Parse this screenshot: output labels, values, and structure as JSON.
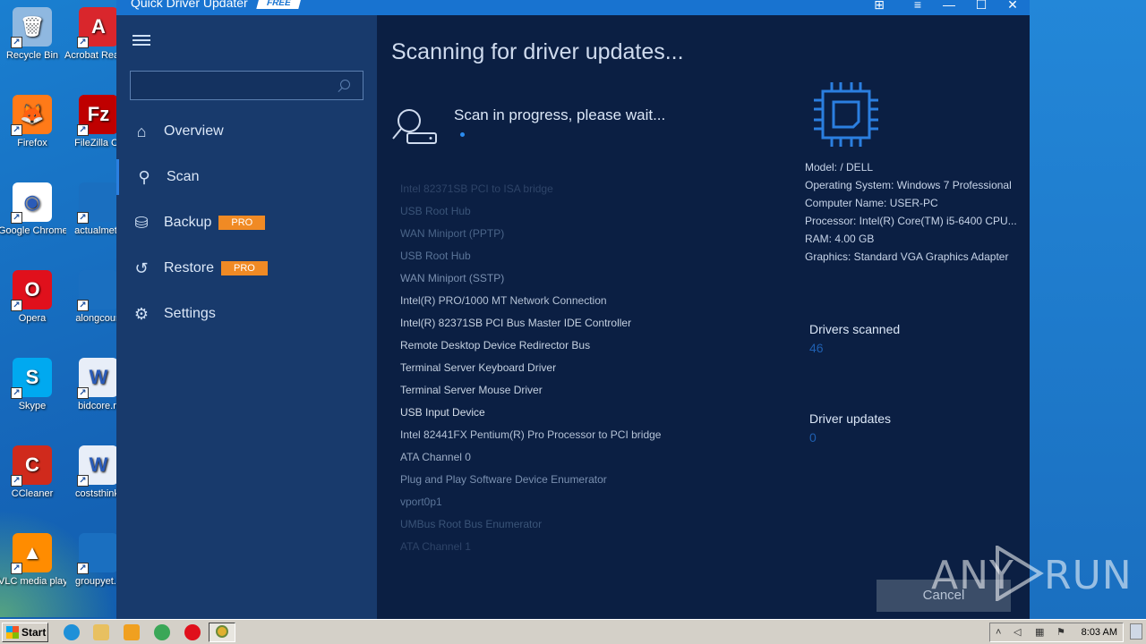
{
  "desktop": {
    "icons": [
      {
        "label": "Recycle Bin",
        "glyph": "🗑",
        "color": "#8fb8e0"
      },
      {
        "label": "Acrobat Reader D",
        "glyph": "A",
        "color": "#d9262c"
      },
      {
        "label": "Firefox",
        "glyph": "🦊",
        "color": "#ff7a18"
      },
      {
        "label": "FileZilla Cli",
        "glyph": "Fz",
        "color": "#bf0000"
      },
      {
        "label": "Google Chrome",
        "glyph": "◉",
        "color": "#ffffff"
      },
      {
        "label": "actualmeta",
        "glyph": "",
        "color": "#1a6fc0"
      },
      {
        "label": "Opera",
        "glyph": "O",
        "color": "#e0101c"
      },
      {
        "label": "alongcourt",
        "glyph": "",
        "color": "#1a6fc0"
      },
      {
        "label": "Skype",
        "glyph": "S",
        "color": "#00a9f0"
      },
      {
        "label": "bidcore.rt",
        "glyph": "W",
        "color": "#e8eef8"
      },
      {
        "label": "CCleaner",
        "glyph": "C",
        "color": "#d02a1c"
      },
      {
        "label": "coststhink.",
        "glyph": "W",
        "color": "#e8eef8"
      },
      {
        "label": "VLC media player",
        "glyph": "▲",
        "color": "#ff8c00"
      },
      {
        "label": "groupyet.p",
        "glyph": "",
        "color": "#1a6fc0"
      }
    ]
  },
  "window": {
    "title": "Quick Driver Updater",
    "edition_badge": "FREE",
    "controls": {
      "gift": "⊞",
      "menu": "≡",
      "minimize": "—",
      "maximize": "☐",
      "close": "✕"
    }
  },
  "sidebar": {
    "search_value": "",
    "nav": [
      {
        "label": "Overview",
        "icon": "home-icon",
        "glyph": "⌂",
        "pro": ""
      },
      {
        "label": "Scan",
        "icon": "scan-icon",
        "glyph": "⚲",
        "pro": ""
      },
      {
        "label": "Backup",
        "icon": "backup-icon",
        "glyph": "⛁",
        "pro": "PRO"
      },
      {
        "label": "Restore",
        "icon": "restore-icon",
        "glyph": "↺",
        "pro": "PRO"
      },
      {
        "label": "Settings",
        "icon": "gear-icon",
        "glyph": "⚙",
        "pro": ""
      }
    ]
  },
  "main": {
    "heading": "Scanning for driver updates...",
    "scan_status": "Scan in progress, please wait...",
    "drivers": [
      {
        "name": "Intel 82371SB PCI to ISA bridge",
        "color": "#2e4468"
      },
      {
        "name": "USB Root Hub",
        "color": "#3a5478"
      },
      {
        "name": "WAN Miniport (PPTP)",
        "color": "#4a6488"
      },
      {
        "name": "USB Root Hub",
        "color": "#5a7498"
      },
      {
        "name": "WAN Miniport (SSTP)",
        "color": "#7a90b0"
      },
      {
        "name": "Intel(R) PRO/1000 MT Network Connection",
        "color": "#b4c2d6"
      },
      {
        "name": "Intel(R) 82371SB PCI Bus Master IDE Controller",
        "color": "#c4d0e0"
      },
      {
        "name": "Remote Desktop Device Redirector Bus",
        "color": "#c4d0e0"
      },
      {
        "name": "Terminal Server Keyboard Driver",
        "color": "#c4d0e0"
      },
      {
        "name": "Terminal Server Mouse Driver",
        "color": "#c4d0e0"
      },
      {
        "name": "USB Input Device",
        "color": "#d4dde9"
      },
      {
        "name": "Intel 82441FX Pentium(R) Pro Processor to PCI bridge",
        "color": "#b4c2d6"
      },
      {
        "name": "ATA Channel 0",
        "color": "#a0b0c8"
      },
      {
        "name": "Plug and Play Software Device Enumerator",
        "color": "#7a90b0"
      },
      {
        "name": "vport0p1",
        "color": "#5a7498"
      },
      {
        "name": "UMBus Root Bus Enumerator",
        "color": "#3a5478"
      },
      {
        "name": "ATA Channel 1",
        "color": "#2e4468"
      }
    ],
    "system_info": [
      "Model:  / DELL",
      "Operating System: Windows 7 Professional",
      "Computer Name: USER-PC",
      " Processor: Intel(R) Core(TM) i5-6400 CPU...",
      "RAM: 4.00 GB",
      "Graphics: Standard VGA Graphics Adapter"
    ],
    "drivers_scanned_label": "Drivers scanned",
    "drivers_scanned_value": "46",
    "driver_updates_label": "Driver updates",
    "driver_updates_value": "0",
    "cancel_label": "Cancel"
  },
  "watermark": {
    "text_left": "ANY",
    "text_right": "RUN"
  },
  "taskbar": {
    "start_label": "Start",
    "clock": "8:03 AM",
    "pinned": [
      {
        "icon": "ie-icon",
        "color": "#1e90d8"
      },
      {
        "icon": "explorer-icon",
        "color": "#e8c060"
      },
      {
        "icon": "media-player-icon",
        "color": "#f0a020"
      },
      {
        "icon": "chrome-icon",
        "color": "#3aa757"
      },
      {
        "icon": "opera-icon",
        "color": "#e0101c"
      }
    ]
  }
}
